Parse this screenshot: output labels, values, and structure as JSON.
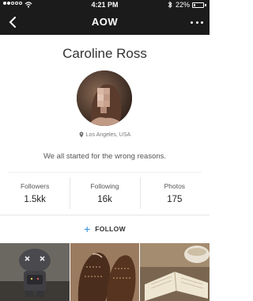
{
  "status_bar": {
    "time": "4:21 PM",
    "battery": "22%",
    "battery_level": 0.22
  },
  "nav": {
    "title": "AOW",
    "back_icon": "chevron-left-icon",
    "more_icon": "more-dots-icon"
  },
  "profile": {
    "name": "Caroline Ross",
    "location": "Los Angeles, USA",
    "bio": "We all started for the wrong reasons."
  },
  "stats": [
    {
      "label": "Followers",
      "value": "1.5kk"
    },
    {
      "label": "Following",
      "value": "16k"
    },
    {
      "label": "Photos",
      "value": "175"
    }
  ],
  "follow": {
    "label": "FOLLOW",
    "accent": "#2a8fd4"
  },
  "colors": {
    "bar": "#1b1b1b",
    "accent": "#2a8fd4"
  }
}
